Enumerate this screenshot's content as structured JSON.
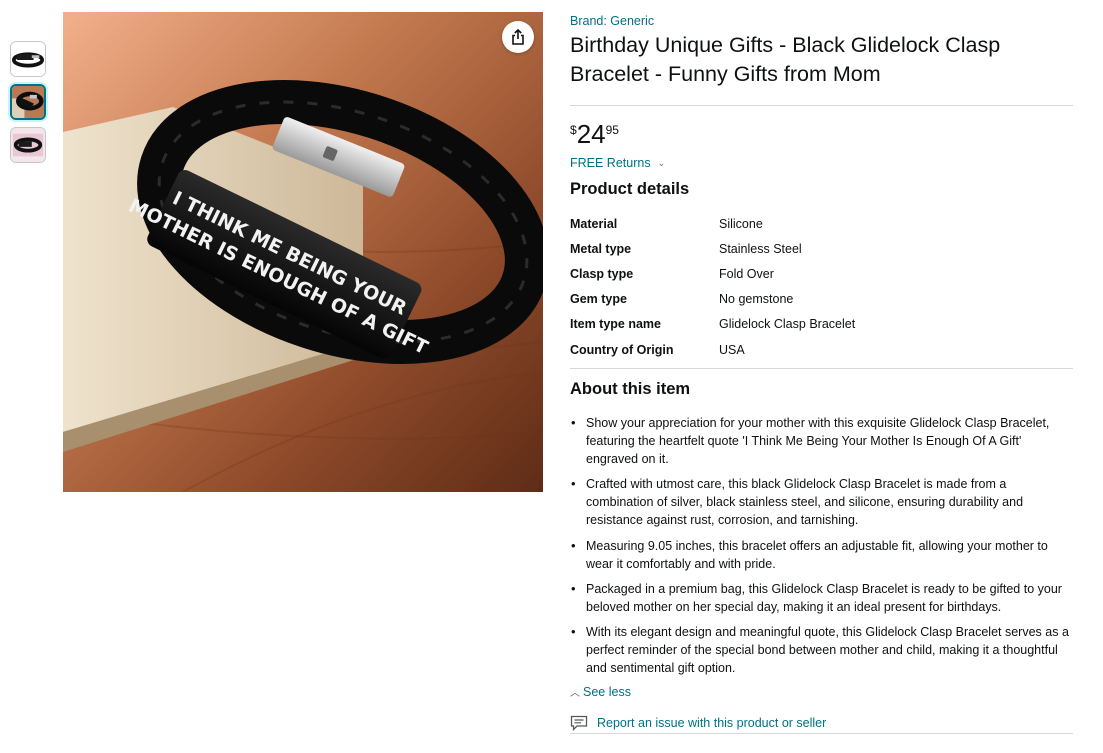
{
  "thumbnails": [
    {
      "icon": "bracelet-thumbnail",
      "active": false
    },
    {
      "icon": "bracelet-thumbnail",
      "active": true
    },
    {
      "icon": "bracelet-box-thumbnail",
      "active": false
    }
  ],
  "main_image": {
    "engraving_line1": "I THINK ME BEING YOUR",
    "engraving_line2": "MOTHER IS ENOUGH OF A GIFT",
    "share_icon": "share-icon"
  },
  "product": {
    "brand": "Brand: Generic",
    "title": "Birthday Unique Gifts - Black Glidelock Clasp Bracelet - Funny Gifts from Mom",
    "price_symbol": "$",
    "price_whole": "24",
    "price_fraction": "95",
    "returns": "FREE Returns"
  },
  "product_details": {
    "heading": "Product details",
    "rows": [
      {
        "key": "Material",
        "value": "Silicone"
      },
      {
        "key": "Metal type",
        "value": "Stainless Steel"
      },
      {
        "key": "Clasp type",
        "value": "Fold Over"
      },
      {
        "key": "Gem type",
        "value": "No gemstone"
      },
      {
        "key": "Item type name",
        "value": "Glidelock Clasp Bracelet"
      },
      {
        "key": "Country of Origin",
        "value": "USA"
      }
    ]
  },
  "about": {
    "heading": "About this item",
    "bullets": [
      "Show your appreciation for your mother with this exquisite Glidelock Clasp Bracelet, featuring the heartfelt quote 'I Think Me Being Your Mother Is Enough Of A Gift' engraved on it.",
      "Crafted with utmost care, this black Glidelock Clasp Bracelet is made from a combination of silver, black stainless steel, and silicone, ensuring durability and resistance against rust, corrosion, and tarnishing.",
      "Measuring 9.05 inches, this bracelet offers an adjustable fit, allowing your mother to wear it comfortably and with pride.",
      "Packaged in a premium bag, this Glidelock Clasp Bracelet is ready to be gifted to your beloved mother on her special day, making it an ideal present for birthdays.",
      "With its elegant design and meaningful quote, this Glidelock Clasp Bracelet serves as a perfect reminder of the special bond between mother and child, making it a thoughtful and sentimental gift option."
    ],
    "see_less": "See less"
  },
  "report": {
    "label": "Report an issue with this product or seller",
    "icon": "report-icon"
  },
  "colors": {
    "link": "#007185",
    "text": "#0f1111",
    "divider": "#d5d9d9"
  }
}
